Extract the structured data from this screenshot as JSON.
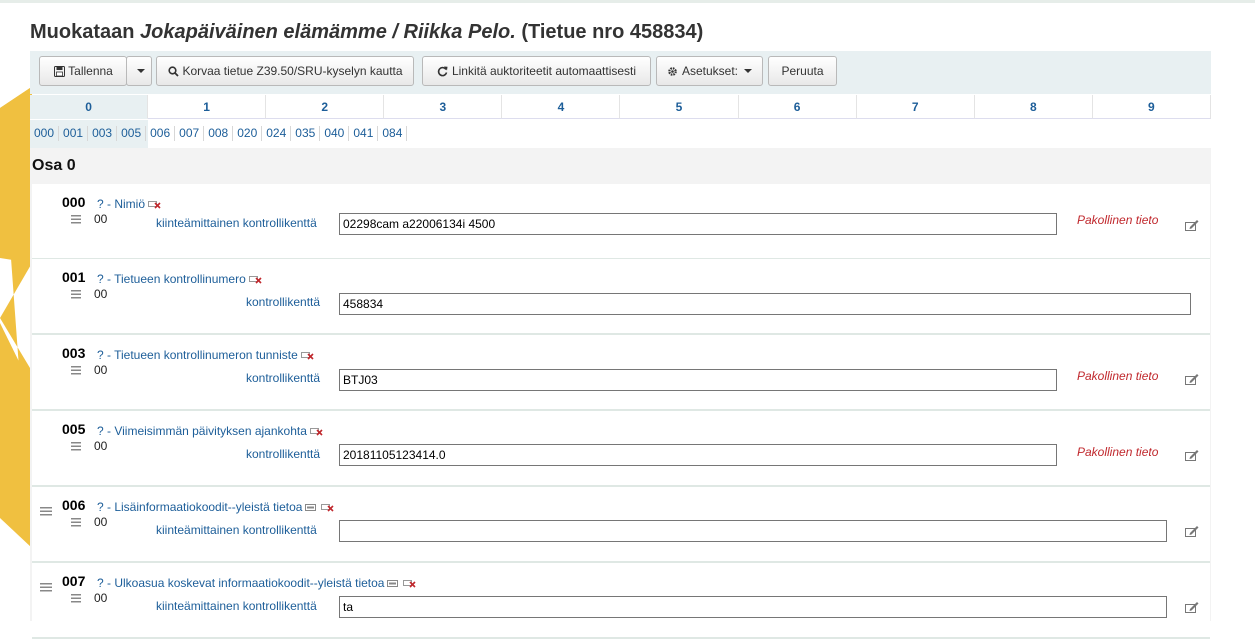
{
  "page": {
    "title_prefix": "Muokataan ",
    "title_italic": "Jokapäiväinen elämämme / Riikka Pelo.",
    "title_suffix": " (Tietue nro 458834)"
  },
  "toolbar": {
    "save_label": "Tallenna",
    "z3950_label": "Korvaa tietue Z39.50/SRU-kyselyn kautta",
    "link_auth_label": "Linkitä auktoriteetit automaattisesti",
    "settings_label": "Asetukset:",
    "cancel_label": "Peruuta"
  },
  "tabs": [
    "0",
    "1",
    "2",
    "3",
    "4",
    "5",
    "6",
    "7",
    "8",
    "9"
  ],
  "active_tab": "0",
  "field_links": [
    "000",
    "001",
    "003",
    "005",
    "006",
    "007",
    "008",
    "020",
    "024",
    "035",
    "040",
    "041",
    "084"
  ],
  "section_title": "Osa 0",
  "fields": [
    {
      "tag": "000",
      "desc": "? - Nimiö",
      "indicators": "00",
      "sublabel": "kiinteämittainen kontrollikenttä",
      "value": "02298cam a22006134i 4500",
      "mandatory": "Pakollinen tieto"
    },
    {
      "tag": "001",
      "desc": "? - Tietueen kontrollinumero",
      "indicators": "00",
      "sublabel": "kontrollikenttä",
      "value": "458834",
      "mandatory": ""
    },
    {
      "tag": "003",
      "desc": "? - Tietueen kontrollinumeron tunniste",
      "indicators": "00",
      "sublabel": "kontrollikenttä",
      "value": "BTJ03",
      "mandatory": "Pakollinen tieto"
    },
    {
      "tag": "005",
      "desc": "? - Viimeisimmän päivityksen ajankohta",
      "indicators": "00",
      "sublabel": "kontrollikenttä",
      "value": "20181105123414.0",
      "mandatory": "Pakollinen tieto"
    },
    {
      "tag": "006",
      "desc": "? - Lisäinformaatiokoodit--yleistä tietoa",
      "indicators": "00",
      "sublabel": "kiinteämittainen kontrollikenttä",
      "value": "",
      "mandatory": ""
    },
    {
      "tag": "007",
      "desc": "? - Ulkoasua koskevat informaatiokoodit--yleistä tietoa",
      "indicators": "00",
      "sublabel": "kiinteämittainen kontrollikenttä",
      "value": "ta",
      "mandatory": ""
    }
  ],
  "colors": {
    "accent": "#f0c040",
    "link": "#1d5e99",
    "mandatory": "#c0282d",
    "toolbar_bg": "#e8f0f2"
  },
  "icons": {
    "save": "floppy-icon",
    "search": "search-icon",
    "refresh": "refresh-icon",
    "settings": "gear-icon",
    "delete": "delete-field-icon",
    "clone": "clone-field-icon",
    "edit": "edit-icon",
    "drag": "drag-handle-icon"
  }
}
